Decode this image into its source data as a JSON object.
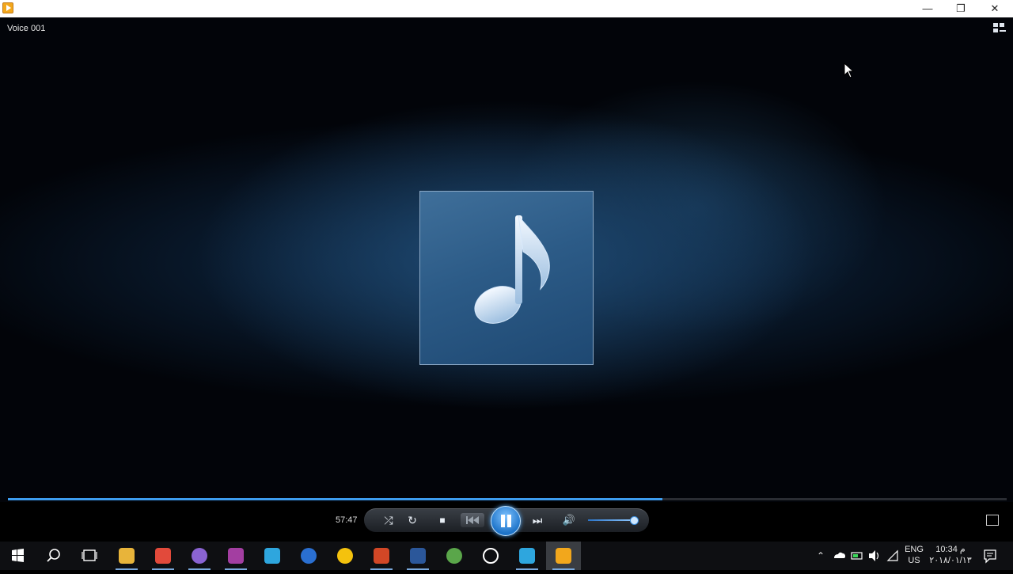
{
  "window": {
    "minimize_glyph": "—",
    "restore_glyph": "❐",
    "close_glyph": "✕"
  },
  "player": {
    "now_playing_title": "Voice 001",
    "elapsed_time": "57:47",
    "seek_progress": 0.655,
    "volume_level": 0.95,
    "state": "playing",
    "accent_color": "#3d9df0",
    "album_art_icon": "music-note-icon"
  },
  "controls": {
    "shuffle_glyph": "⤮",
    "repeat_glyph": "↻",
    "stop_glyph": "■",
    "next_glyph": "⏭",
    "volume_glyph": "🔊"
  },
  "taskbar": {
    "apps": [
      {
        "name": "file-explorer",
        "color": "#e8b43a",
        "open": true
      },
      {
        "name": "app-red",
        "color": "#e24a3b",
        "open": true
      },
      {
        "name": "browser-circle",
        "color": "#8a63d2",
        "open": true
      },
      {
        "name": "pdf-app",
        "color": "#a33ea1",
        "open": true
      },
      {
        "name": "telegram",
        "color": "#2ea6de",
        "open": false
      },
      {
        "name": "thunderbird",
        "color": "#2a6fd1",
        "open": false
      },
      {
        "name": "chrome",
        "color": "#f4c20d",
        "open": false
      },
      {
        "name": "powerpoint",
        "color": "#d24726",
        "open": true
      },
      {
        "name": "word",
        "color": "#2b579a",
        "open": true
      },
      {
        "name": "map-app",
        "color": "#5aa64a",
        "open": false
      },
      {
        "name": "alarm-clock",
        "color": "#ffffff",
        "open": false
      },
      {
        "name": "telegram-2",
        "color": "#2ea6de",
        "open": true
      },
      {
        "name": "media-player",
        "color": "#f2a71c",
        "open": true,
        "active": true
      }
    ],
    "tray": {
      "language": "ENG",
      "region": "US",
      "time": "10:34 م",
      "date": "۲۰۱۸/۰۱/۱۳"
    }
  }
}
